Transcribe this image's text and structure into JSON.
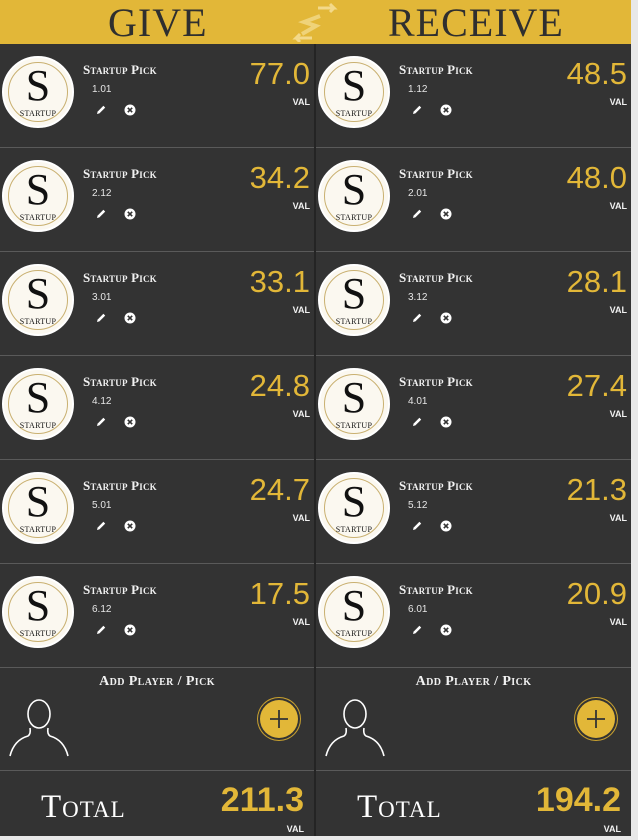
{
  "header": {
    "give_title": "GIVE",
    "receive_title": "RECEIVE"
  },
  "colors": {
    "accent": "#e2b738",
    "panel": "#333333",
    "header_text": "#2f2f2f"
  },
  "icons": {
    "swap": "swap-arrows-icon",
    "edit": "pencil-icon",
    "remove": "remove-x-icon",
    "add": "plus-icon",
    "placeholder": "person-silhouette-icon"
  },
  "logo": {
    "letter": "S",
    "word": "STARTUP"
  },
  "val_label": "VAL",
  "give": {
    "items": [
      {
        "name": "Startup Pick",
        "slot": "1.01",
        "value": "77.0"
      },
      {
        "name": "Startup Pick",
        "slot": "2.12",
        "value": "34.2"
      },
      {
        "name": "Startup Pick",
        "slot": "3.01",
        "value": "33.1"
      },
      {
        "name": "Startup Pick",
        "slot": "4.12",
        "value": "24.8"
      },
      {
        "name": "Startup Pick",
        "slot": "5.01",
        "value": "24.7"
      },
      {
        "name": "Startup Pick",
        "slot": "6.12",
        "value": "17.5"
      }
    ],
    "add_label": "Add Player / Pick",
    "total_label": "Total",
    "total_value": "211.3"
  },
  "receive": {
    "items": [
      {
        "name": "Startup Pick",
        "slot": "1.12",
        "value": "48.5"
      },
      {
        "name": "Startup Pick",
        "slot": "2.01",
        "value": "48.0"
      },
      {
        "name": "Startup Pick",
        "slot": "3.12",
        "value": "28.1"
      },
      {
        "name": "Startup Pick",
        "slot": "4.01",
        "value": "27.4"
      },
      {
        "name": "Startup Pick",
        "slot": "5.12",
        "value": "21.3"
      },
      {
        "name": "Startup Pick",
        "slot": "6.01",
        "value": "20.9"
      }
    ],
    "add_label": "Add Player / Pick",
    "total_label": "Total",
    "total_value": "194.2"
  }
}
